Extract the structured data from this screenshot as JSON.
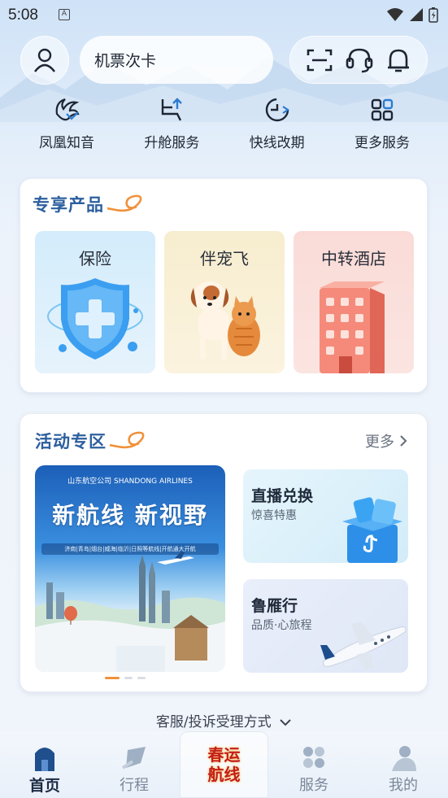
{
  "status_bar": {
    "time": "5:08",
    "notification_icon": "a-icon"
  },
  "header": {
    "search_text": "机票次卡",
    "tools": [
      "scan-icon",
      "headset-icon",
      "bell-icon"
    ]
  },
  "quick_services": [
    {
      "label": "凤凰知音",
      "icon": "phoenix-icon"
    },
    {
      "label": "升舱服务",
      "icon": "seat-upgrade-icon"
    },
    {
      "label": "快线改期",
      "icon": "clock-change-icon"
    },
    {
      "label": "更多服务",
      "icon": "grid-icon"
    }
  ],
  "exclusive": {
    "title": "专享产品",
    "products": [
      {
        "label": "保险",
        "icon": "shield-plus-icon"
      },
      {
        "label": "伴宠飞",
        "icon": "pets-icon"
      },
      {
        "label": "中转酒店",
        "icon": "hotel-building-icon"
      }
    ]
  },
  "activity": {
    "title": "活动专区",
    "more": "更多",
    "banner": {
      "logo": "山东航空公司 SHANDONG AIRLINES",
      "headline": "新航线 新视野",
      "sub": "济南|青岛|烟台|威海|临沂|日照等航线|开航通大开航"
    },
    "carousel_index": 0,
    "carousel_count": 3,
    "promos": [
      {
        "title": "直播兑换",
        "subtitle": "惊喜特惠",
        "icon": "gift-box-icon"
      },
      {
        "title": "鲁雁行",
        "subtitle": "品质·心旅程",
        "icon": "airplane-icon"
      }
    ]
  },
  "complaint_link": "客服/投诉受理方式",
  "bottom_nav": {
    "tabs": [
      {
        "label": "首页",
        "active": true
      },
      {
        "label": "行程",
        "active": false
      },
      {
        "label": "服务",
        "active": false
      },
      {
        "label": "我的",
        "active": false
      }
    ],
    "center_badge": "春运航线"
  },
  "colors": {
    "brand_blue": "#2c5f9e",
    "accent_orange": "#f0913a"
  }
}
